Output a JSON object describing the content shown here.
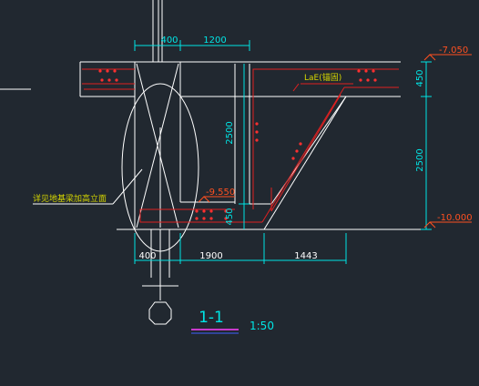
{
  "drawing": {
    "colors": {
      "background": "#212830",
      "outline": "#ffffff",
      "dimension": "#00e5e5",
      "rebar": "#e02020",
      "rebar_dot": "#ff3030",
      "level_mark": "#ff5020",
      "annotation": "#d6d600",
      "underline_title": "#ff40ff",
      "underline_title2": "#4060ff",
      "bearing_dot": "#ff60ff"
    },
    "dimensions": {
      "top_left": "400",
      "top_right": "1200",
      "vert_right_top": "450",
      "vert_right_main": "2500",
      "vert_inner": "2500",
      "vert_inner_small": "450",
      "bottom_left": "400",
      "bottom_mid": "1900",
      "bottom_right": "1443"
    },
    "levels": {
      "top": "-7.050",
      "mid": "-9.550",
      "bottom": "-10.000"
    },
    "labels": {
      "anchorage": "LaE(锚固)",
      "see_note": "详见地基梁加高立面",
      "section_title": "1-1",
      "scale": "1:50"
    }
  }
}
